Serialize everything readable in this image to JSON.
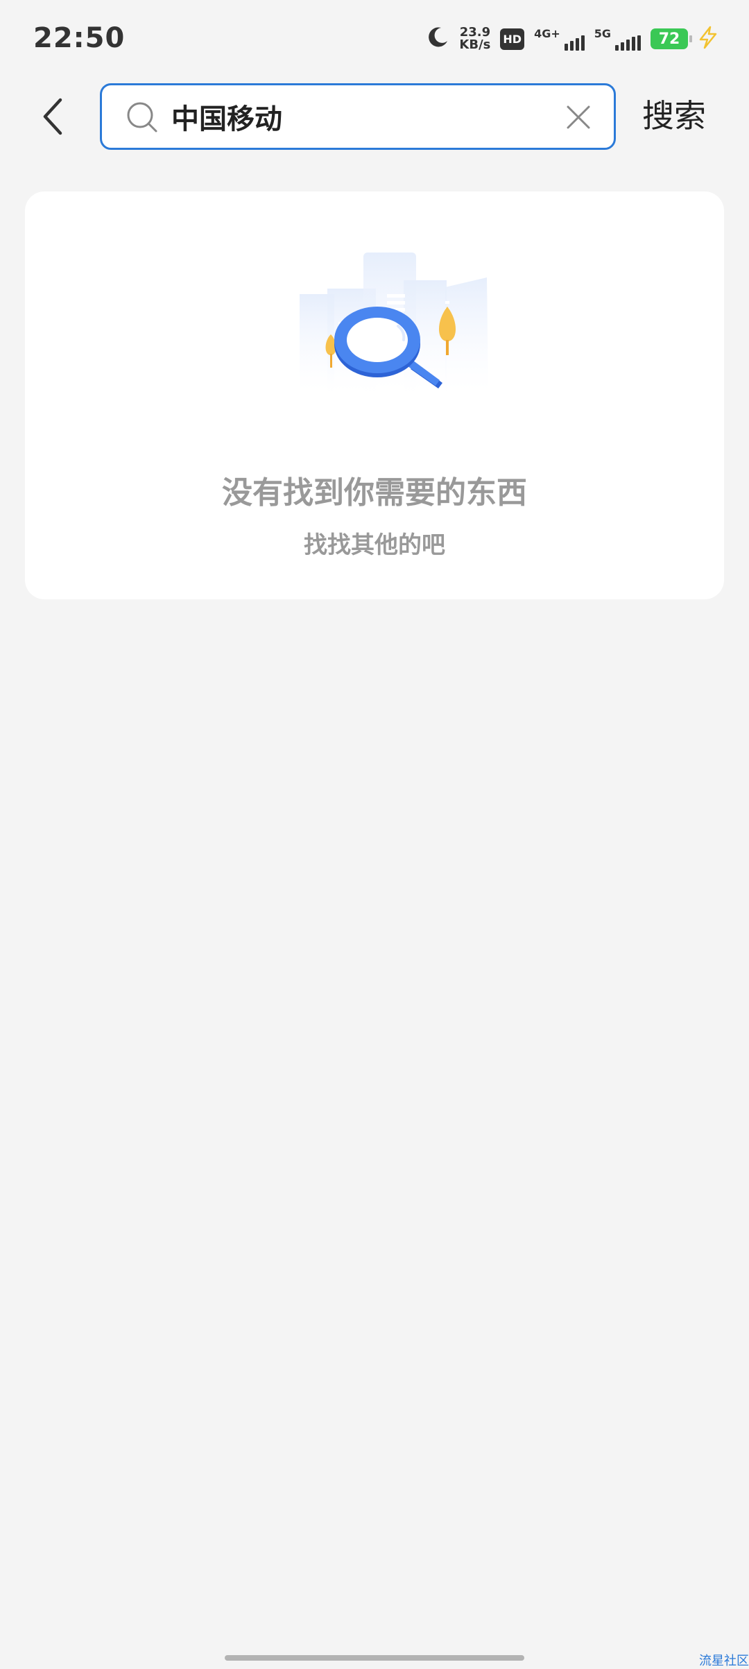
{
  "status_bar": {
    "time": "22:50",
    "net_speed_value": "23.9",
    "net_speed_unit": "KB/s",
    "hd_label": "HD",
    "sim1_label": "4G+",
    "sim2_label": "5G",
    "battery_level": "72",
    "icons": [
      "moon-icon",
      "hd-icon",
      "signal-4g-icon",
      "signal-5g-icon",
      "battery-icon",
      "charging-icon"
    ]
  },
  "header": {
    "back_icon": "chevron-left-icon",
    "search": {
      "value": "中国移动",
      "icon": "search-icon",
      "clear_icon": "close-icon"
    },
    "search_button_label": "搜索"
  },
  "empty_state": {
    "title": "没有找到你需要的东西",
    "subtitle": "找找其他的吧",
    "illustration": "magnifier-illustration"
  },
  "colors": {
    "accent": "#2b7ad8",
    "background": "#f4f4f4",
    "card": "#ffffff",
    "muted_text": "#999999",
    "battery": "#3ac855"
  },
  "watermark": "流星社区"
}
